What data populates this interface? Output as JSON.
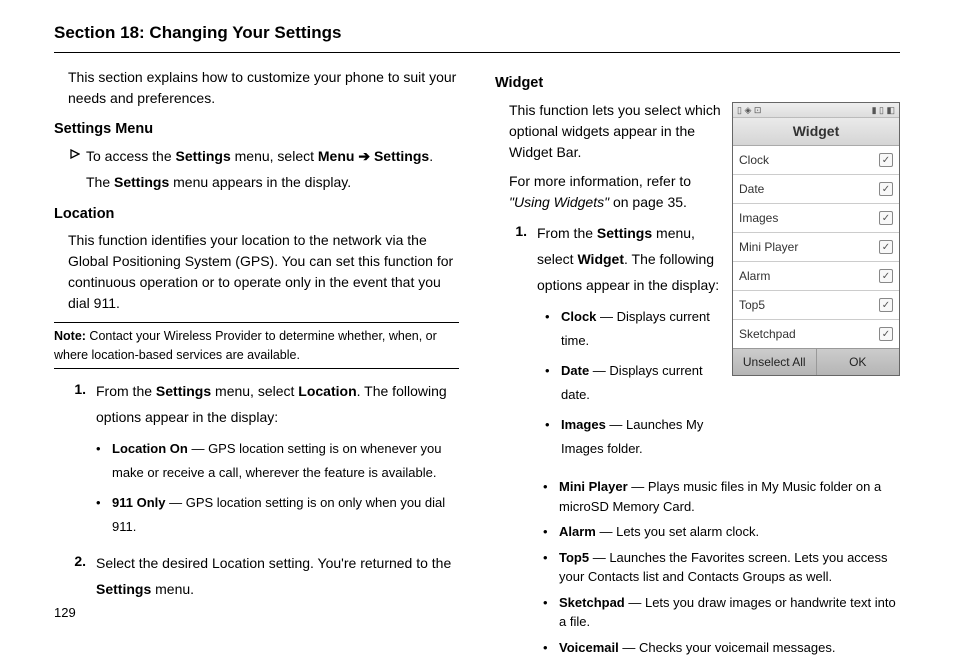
{
  "section_title": "Section 18: Changing Your Settings",
  "page_number": "129",
  "left": {
    "intro": "This section explains how to customize your phone to suit your needs and preferences.",
    "settings_menu": {
      "heading": "Settings Menu",
      "access_pre": "To access the ",
      "access_bold1": "Settings",
      "access_mid1": " menu, select ",
      "access_bold2": "Menu",
      "access_arrow": " ➔ ",
      "access_bold3": "Settings",
      "access_mid2": ". The ",
      "access_bold4": "Settings",
      "access_end": " menu appears in the display."
    },
    "location": {
      "heading": "Location",
      "body": "This function identifies your location to the network via the Global Positioning System (GPS). You can set this function for continuous operation or to operate only in the event that you dial 911.",
      "note_label": "Note:",
      "note_body": " Contact your Wireless Provider to determine whether, when, or where location-based services are available.",
      "step1_pre": "From the ",
      "step1_b1": "Settings",
      "step1_mid": " menu, select ",
      "step1_b2": "Location",
      "step1_end": ". The following options appear in the display:",
      "bul1_b": "Location On",
      "bul1_t": " — GPS location setting is on whenever you make or receive a call, wherever the feature is available.",
      "bul2_b": "911 Only",
      "bul2_t": " — GPS location setting is on only when you dial 911.",
      "step2_pre": "Select the desired Location setting. You're returned to the ",
      "step2_b": "Settings",
      "step2_end": " menu."
    }
  },
  "right": {
    "widget": {
      "heading": "Widget",
      "intro": "This function lets you select which optional widgets appear in the Widget Bar.",
      "refer_pre": "For more information, refer to ",
      "refer_ital": "\"Using Widgets\"",
      "refer_end": "  on page 35.",
      "step1_pre": "From the ",
      "step1_b1": "Settings",
      "step1_mid": " menu, select ",
      "step1_b2": "Widget",
      "step1_end": ". The following options appear in the display:",
      "items": [
        {
          "b": "Clock",
          "t": " — Displays current time."
        },
        {
          "b": "Date",
          "t": " — Displays current date."
        },
        {
          "b": "Images",
          "t": " — Launches My Images folder."
        },
        {
          "b": "Mini Player",
          "t": " — Plays music files in My Music folder on a microSD Memory Card."
        },
        {
          "b": "Alarm",
          "t": " — Lets you set alarm clock."
        },
        {
          "b": "Top5",
          "t": " — Launches the Favorites screen. Lets you access your Contacts list and Contacts Groups as well."
        },
        {
          "b": "Sketchpad",
          "t": " — Lets you draw images or handwrite text into a file."
        },
        {
          "b": "Voicemail",
          "t": " — Checks your voicemail messages."
        }
      ]
    }
  },
  "phone": {
    "title": "Widget",
    "status_left": "▯ ◈ ⊡",
    "status_right": "▮ ▯ ◧",
    "rows": [
      "Clock",
      "Date",
      "Images",
      "Mini Player",
      "Alarm",
      "Top5",
      "Sketchpad"
    ],
    "soft_left": "Unselect All",
    "soft_right": "OK"
  }
}
